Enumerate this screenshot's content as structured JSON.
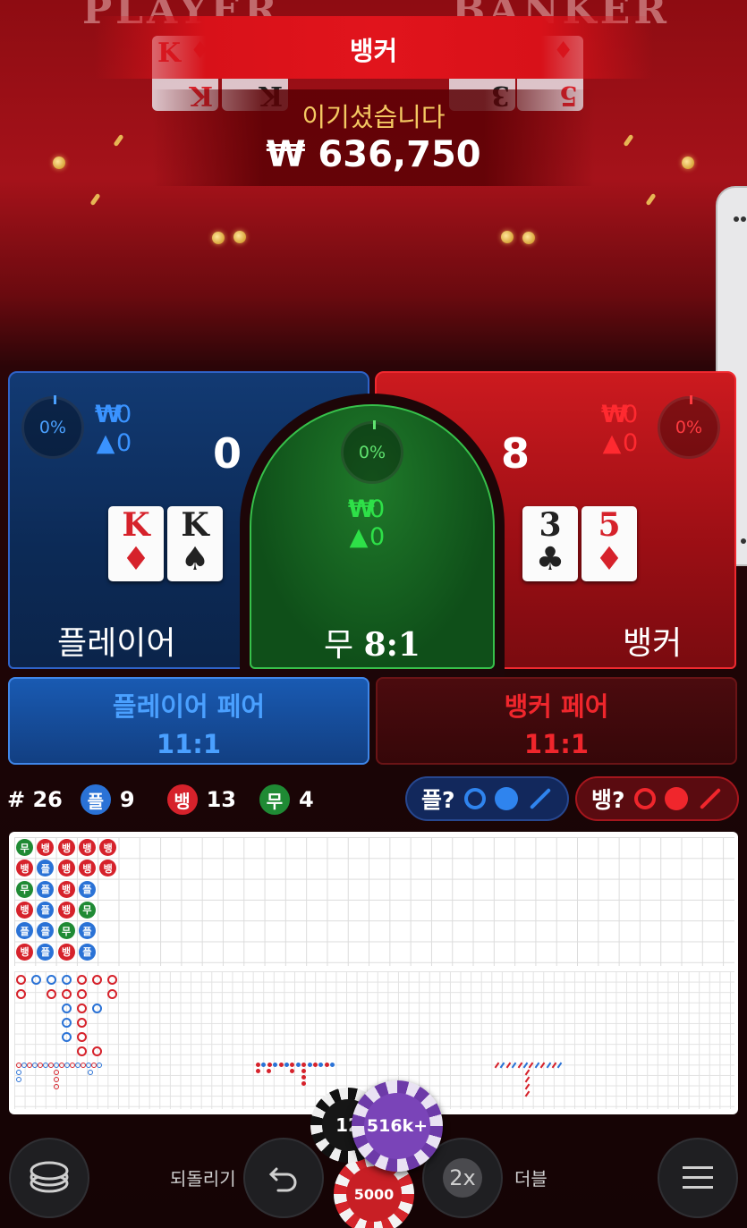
{
  "header": {
    "player_ghost": "PLAYER",
    "banker_ghost": "BANKER",
    "result_banner": "뱅커",
    "win_label": "이기셨습니다",
    "win_amount": "₩ 636,750",
    "ghost_cards": [
      {
        "rank": "K",
        "suit": "♦",
        "color": "red"
      },
      {
        "rank": "K",
        "suit": "♠",
        "color": "black"
      },
      {
        "rank": "3",
        "suit": "♣",
        "color": "black"
      },
      {
        "rank": "5",
        "suit": "♦",
        "color": "red"
      }
    ]
  },
  "player": {
    "label": "플레이어",
    "percent": "0%",
    "bet_amount": "0",
    "bettors": "0",
    "score": "0",
    "cards": [
      {
        "rank": "K",
        "suit": "♦",
        "color": "red"
      },
      {
        "rank": "K",
        "suit": "♠",
        "color": "black"
      }
    ],
    "color": "#2f62c7"
  },
  "tie": {
    "label": "무",
    "odds": "8:1",
    "percent": "0%",
    "bet_amount": "0",
    "bettors": "0",
    "color": "#37c14b"
  },
  "banker": {
    "label": "뱅커",
    "percent": "0%",
    "bet_amount": "0",
    "bettors": "0",
    "score": "8",
    "cards": [
      {
        "rank": "3",
        "suit": "♣",
        "color": "black"
      },
      {
        "rank": "5",
        "suit": "♦",
        "color": "red"
      }
    ],
    "color": "#f0292f"
  },
  "currency_symbol": "₩",
  "player_pair": {
    "label": "플레이어 페어",
    "odds": "11:1"
  },
  "banker_pair": {
    "label": "뱅커 페어",
    "odds": "11:1"
  },
  "stats": {
    "round": "# 26",
    "player_badge": "플",
    "player_count": "9",
    "banker_badge": "뱅",
    "banker_count": "13",
    "tie_badge": "무",
    "tie_count": "4"
  },
  "predict": {
    "player_label": "플?",
    "banker_label": "뱅?"
  },
  "bead_road": [
    [
      "무",
      "뱅",
      "뱅",
      "뱅",
      "뱅"
    ],
    [
      "뱅",
      "플",
      "뱅",
      "뱅",
      "뱅"
    ],
    [
      "무",
      "플",
      "뱅",
      "플"
    ],
    [
      "뱅",
      "플",
      "뱅",
      "무"
    ],
    [
      "플",
      "플",
      "무",
      "플"
    ],
    [
      "뱅",
      "플",
      "뱅",
      "플"
    ]
  ],
  "controls": {
    "undo_label": "되돌리기",
    "double_label": "더블",
    "double_icon_text": "2x",
    "chip_top_label": "516k+",
    "chip_left_label": "12",
    "chip_bottom_label": "5000"
  }
}
